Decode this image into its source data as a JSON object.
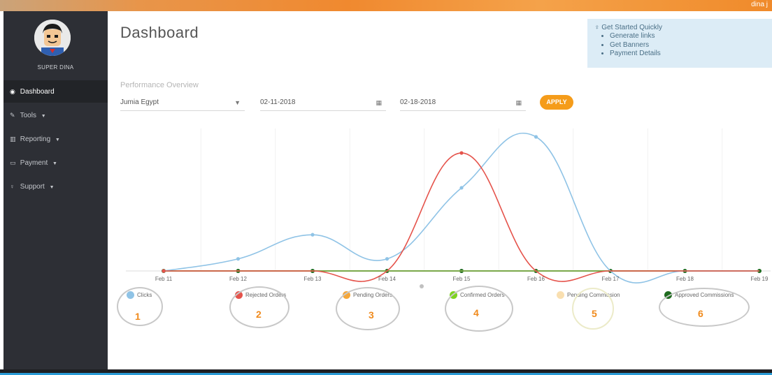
{
  "header": {
    "user_name": "dina j"
  },
  "sidebar": {
    "user_name": "SUPER DINA",
    "items": [
      {
        "label": "Dashboard",
        "icon": "dashboard-icon",
        "active": true
      },
      {
        "label": "Tools",
        "icon": "edit-icon",
        "active": false
      },
      {
        "label": "Reporting",
        "icon": "bar-chart-icon",
        "active": false
      },
      {
        "label": "Payment",
        "icon": "money-icon",
        "active": false
      },
      {
        "label": "Support",
        "icon": "bulb-icon",
        "active": false
      }
    ]
  },
  "main": {
    "title": "Dashboard",
    "info": {
      "heading": "Get Started Quickly",
      "links": [
        "Generate links",
        "Get Banners",
        "Payment Details"
      ]
    },
    "section_title": "Performance Overview",
    "filters": {
      "store": "Jumia Egypt",
      "date_from": "02-11-2018",
      "date_to": "02-18-2018",
      "apply_label": "APPLY"
    }
  },
  "chart_data": {
    "type": "line",
    "x": [
      "Feb 11",
      "Feb 12",
      "Feb 13",
      "Feb 14",
      "Feb 15",
      "Feb 16",
      "Feb 17",
      "Feb 18",
      "Feb 19"
    ],
    "ylim": [
      0,
      10
    ],
    "grid": true,
    "legend_position": "bottom",
    "series": [
      {
        "name": "Clicks",
        "color": "#8fc3e6",
        "values": [
          0,
          0.9,
          2.7,
          0.9,
          6.2,
          10,
          0,
          0,
          0
        ]
      },
      {
        "name": "Rejected Orders",
        "color": "#e5534b",
        "values": [
          0,
          0,
          0,
          0,
          8.8,
          0,
          0,
          0,
          0
        ]
      },
      {
        "name": "Pending Orders",
        "color": "#f5a73a",
        "values": [
          0,
          0,
          0,
          0,
          0,
          0,
          0,
          0,
          0
        ]
      },
      {
        "name": "Confirmed Orders",
        "color": "#7ed321",
        "values": [
          0,
          0,
          0,
          0,
          0,
          0,
          0,
          0,
          0
        ]
      },
      {
        "name": "Pending Commission",
        "color": "#f9dfb0",
        "values": [
          0,
          0,
          0,
          0,
          0,
          0,
          0,
          0,
          0
        ]
      },
      {
        "name": "Approved Commissions",
        "color": "#1f6b1f",
        "values": [
          0,
          0,
          0,
          0,
          0,
          0,
          0,
          0,
          0
        ]
      }
    ]
  },
  "annotations": [
    "1",
    "2",
    "3",
    "4",
    "5",
    "6"
  ]
}
